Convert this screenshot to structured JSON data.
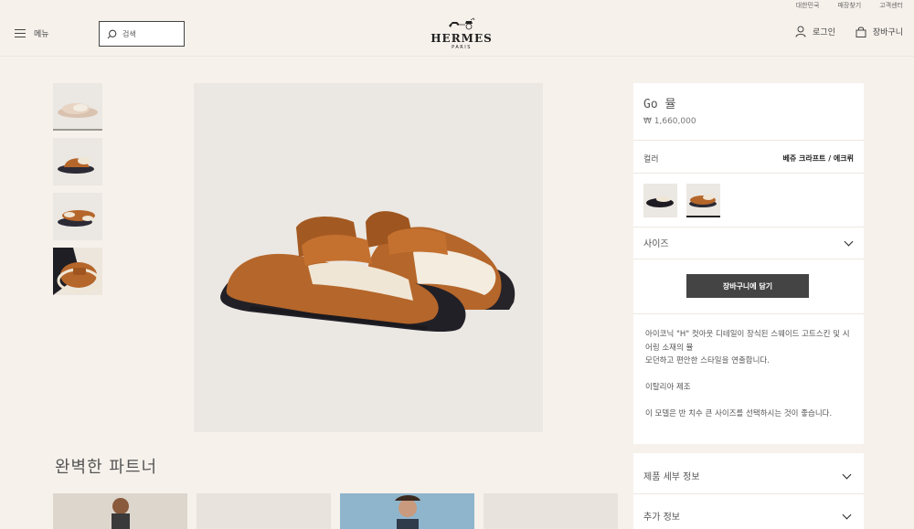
{
  "utility": {
    "links": [
      "대한민국",
      "매장찾기",
      "고객센터"
    ]
  },
  "header": {
    "menu_label": "메뉴",
    "search_placeholder": "검색",
    "logo_name": "HERMES",
    "logo_city": "PARIS",
    "login_label": "로그인",
    "cart_label": "장바구니"
  },
  "gallery": {
    "thumbnails": [
      "thumb-1",
      "thumb-2",
      "thumb-3",
      "thumb-4"
    ],
    "active_index": 0
  },
  "section": {
    "title": "완벽한 파트너"
  },
  "product": {
    "title": "Go 뮬",
    "price": "₩ 1,660,000",
    "color_label": "컬러",
    "color_value": "베쥬 크라프트 / 에크뤼",
    "size_label": "사이즈",
    "add_to_cart": "장바구니에 담기",
    "description": [
      "아이코닉 \"H\" 컷아웃 디테일이 장식된 스웨이드 고트스킨 및 시어링 소재의 뮬\n모던하고 편안한 스타일을 연출합니다.",
      "이탈리아 제조",
      "이 모델은 반 치수 큰 사이즈를 선택하시는 것이 좋습니다."
    ],
    "accordion": [
      "제품 세부 정보",
      "추가 정보"
    ]
  },
  "colors": {
    "accent": "#444444",
    "background": "#f6f1eb",
    "panel": "#ffffff",
    "suede": "#b5662a"
  }
}
